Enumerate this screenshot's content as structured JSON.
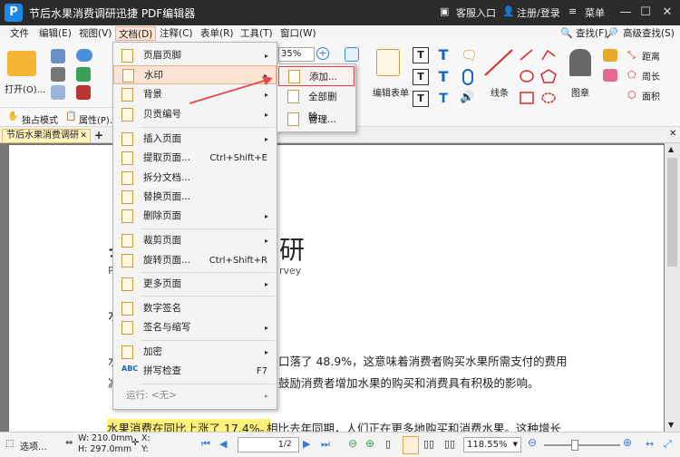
{
  "titlebar": {
    "logo": "P",
    "title": "节后水果消费调研迅捷 PDF编辑器",
    "service": "客服入口",
    "login": "注册/登录",
    "menu": "菜单"
  },
  "menubar": {
    "items": [
      "文件",
      "编辑(E)",
      "视图(V)",
      "文档(D)",
      "注释(C)",
      "表单(R)",
      "工具(T)",
      "窗口(W)"
    ],
    "right": [
      "查找(F)",
      "高级查找(S)"
    ]
  },
  "ribbon": {
    "open": "打开(O)...",
    "zoom": "35%",
    "edit_form": "编辑表单",
    "line": "线条",
    "stamp": "图章",
    "distance": "距离",
    "perimeter": "周长",
    "area": "面积",
    "exclusive_mode": "独占模式",
    "properties": "属性(P)..."
  },
  "tabs": {
    "doc_tab": "节后水果消费调研"
  },
  "document": {
    "title_frag": "研",
    "subtitle_frag": "rvey",
    "line1": "口落了 48.9%，这意味着消费者购买水果所需支付的费用",
    "line2": "鼓励消费者增加水果的购买和消费具有积极的影响。",
    "highlight": "水果消费在同比上涨了 17.4%。",
    "line3": "相比去年同期，人们正在更多地购买和消费水果。这种增长",
    "left_frag1": "水",
    "left_frag2": "减"
  },
  "doc_menu": {
    "items": [
      {
        "label": "页眉页脚",
        "shortcut": "",
        "arrow": "▸"
      },
      {
        "label": "水印",
        "shortcut": "",
        "arrow": "▸"
      },
      {
        "label": "背景",
        "shortcut": "",
        "arrow": "▸"
      },
      {
        "label": "贝贡编号",
        "shortcut": "",
        "arrow": "▸"
      },
      {
        "label": "插入页面",
        "shortcut": "",
        "arrow": "▸"
      },
      {
        "label": "提取页面...",
        "shortcut": "Ctrl+Shift+E",
        "arrow": ""
      },
      {
        "label": "拆分文档...",
        "shortcut": "",
        "arrow": ""
      },
      {
        "label": "替换页面...",
        "shortcut": "",
        "arrow": ""
      },
      {
        "label": "删除页面",
        "shortcut": "",
        "arrow": "▸"
      },
      {
        "label": "裁剪页面",
        "shortcut": "",
        "arrow": "▸"
      },
      {
        "label": "旋转页面...",
        "shortcut": "Ctrl+Shift+R",
        "arrow": ""
      },
      {
        "label": "更多页面",
        "shortcut": "",
        "arrow": "▸"
      },
      {
        "label": "数字签名",
        "shortcut": "",
        "arrow": ""
      },
      {
        "label": "签名与缩写",
        "shortcut": "",
        "arrow": "▸"
      },
      {
        "label": "加密",
        "shortcut": "",
        "arrow": "▸"
      },
      {
        "label": "拼写检查",
        "shortcut": "F7",
        "arrow": ""
      },
      {
        "label": "运行: <无>",
        "shortcut": "",
        "arrow": "▸"
      }
    ]
  },
  "watermark_submenu": {
    "items": [
      "添加...",
      "全部删除...",
      "管理..."
    ]
  },
  "statusbar": {
    "select": "选项...",
    "width": "W: 210.0mm",
    "height": "H: 297.0mm",
    "x": "X:",
    "y": "Y:",
    "page": "1",
    "page_total": "/2",
    "zoom": "118.55%"
  },
  "colors": {
    "menu_highlight": "#fbe4d3",
    "submenu_border": "#e23b3b",
    "arrow": "#e5484d",
    "text_highlight": "#fff27a"
  }
}
